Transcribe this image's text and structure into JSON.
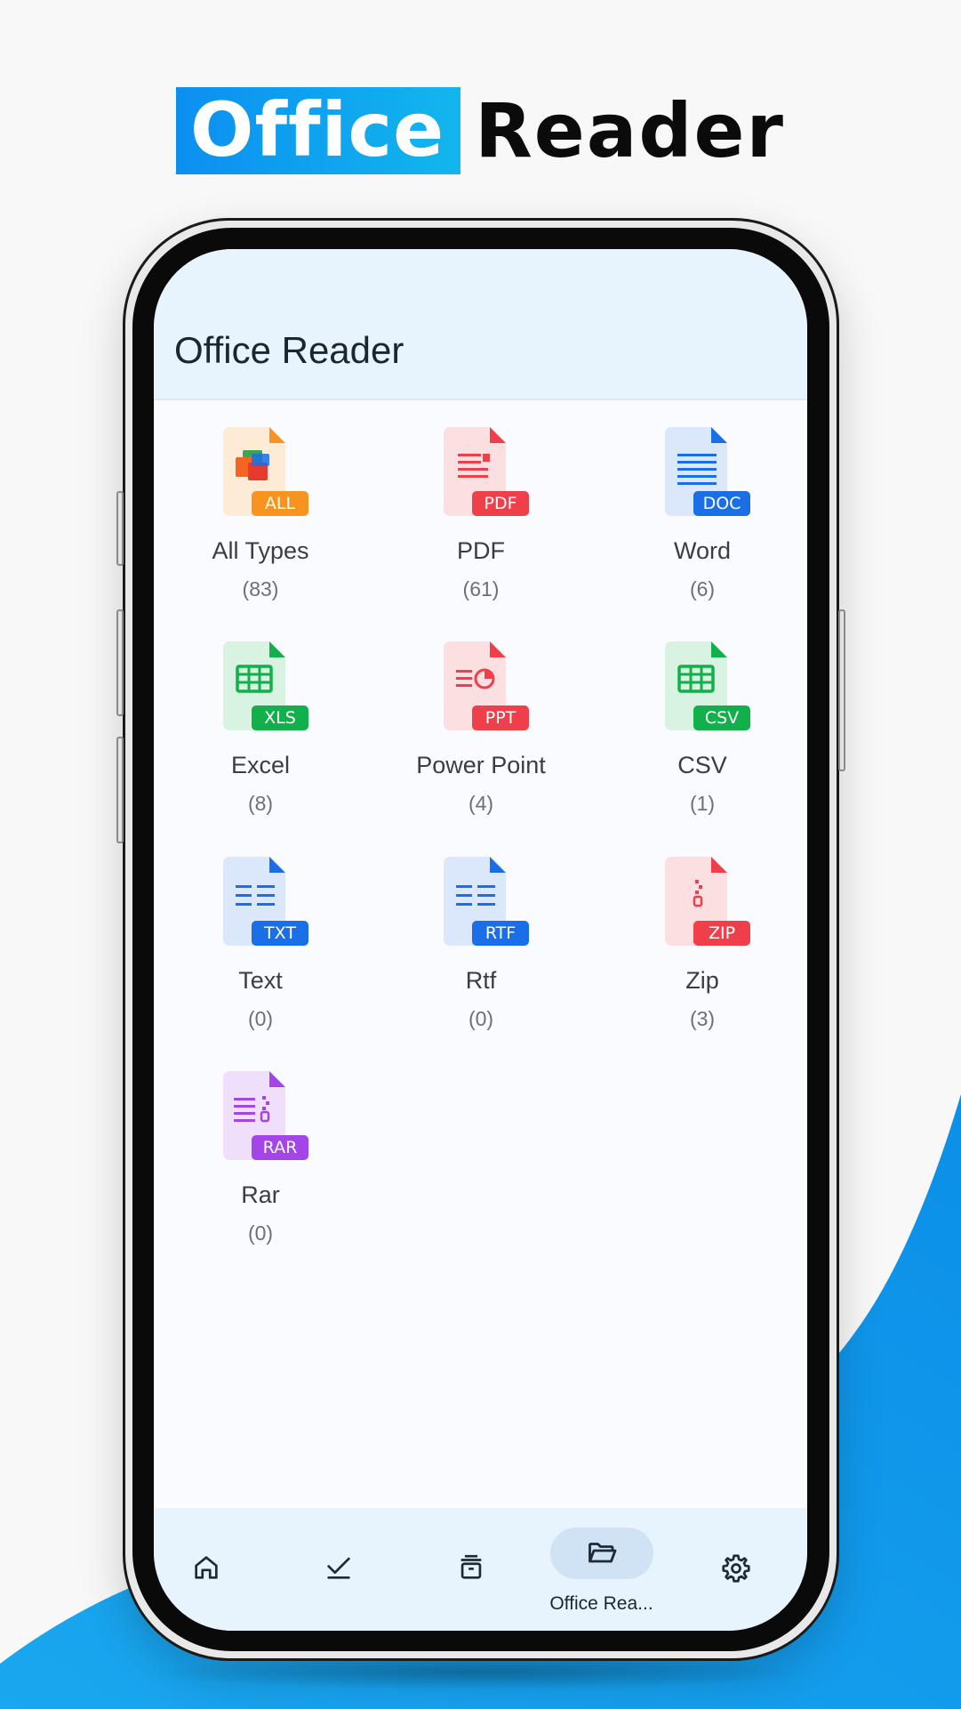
{
  "brand": {
    "part1": "Office",
    "part2": "Reader"
  },
  "appbar": {
    "title": "Office Reader"
  },
  "file_types": [
    {
      "label": "All Types",
      "count": "(83)",
      "badge": "ALL",
      "color": "#f7931e",
      "bg": "#fdebd6",
      "icon": "all-types-icon"
    },
    {
      "label": "PDF",
      "count": "(61)",
      "badge": "PDF",
      "color": "#ee3f4a",
      "bg": "#fcdfe1",
      "icon": "pdf-icon"
    },
    {
      "label": "Word",
      "count": "(6)",
      "badge": "DOC",
      "color": "#1a6fe6",
      "bg": "#dbe7fb",
      "icon": "word-icon"
    },
    {
      "label": "Excel",
      "count": "(8)",
      "badge": "XLS",
      "color": "#11b04a",
      "bg": "#d8f3e1",
      "icon": "excel-icon"
    },
    {
      "label": "Power Point",
      "count": "(4)",
      "badge": "PPT",
      "color": "#ee3f4a",
      "bg": "#fcdfe1",
      "icon": "powerpoint-icon"
    },
    {
      "label": "CSV",
      "count": "(1)",
      "badge": "CSV",
      "color": "#11b04a",
      "bg": "#d8f3e1",
      "icon": "csv-icon"
    },
    {
      "label": "Text",
      "count": "(0)",
      "badge": "TXT",
      "color": "#1a6fe6",
      "bg": "#dbe7fb",
      "icon": "text-icon"
    },
    {
      "label": "Rtf",
      "count": "(0)",
      "badge": "RTF",
      "color": "#1a6fe6",
      "bg": "#dbe7fb",
      "icon": "rtf-icon"
    },
    {
      "label": "Zip",
      "count": "(3)",
      "badge": "ZIP",
      "color": "#ee3f4a",
      "bg": "#fcdfe1",
      "icon": "zip-icon"
    },
    {
      "label": "Rar",
      "count": "(0)",
      "badge": "RAR",
      "color": "#a445e8",
      "bg": "#efdffb",
      "icon": "rar-icon"
    }
  ],
  "bottom_nav": {
    "items": [
      {
        "icon": "home-icon",
        "label": ""
      },
      {
        "icon": "check-icon",
        "label": ""
      },
      {
        "icon": "archive-icon",
        "label": ""
      },
      {
        "icon": "folder-open-icon",
        "label": "Office Rea...",
        "active": true
      },
      {
        "icon": "settings-icon",
        "label": ""
      }
    ]
  },
  "colors": {
    "accent": "#0c8ff0",
    "appbar_bg": "#e7f3fd",
    "nav_pill": "#cfe3f4"
  }
}
